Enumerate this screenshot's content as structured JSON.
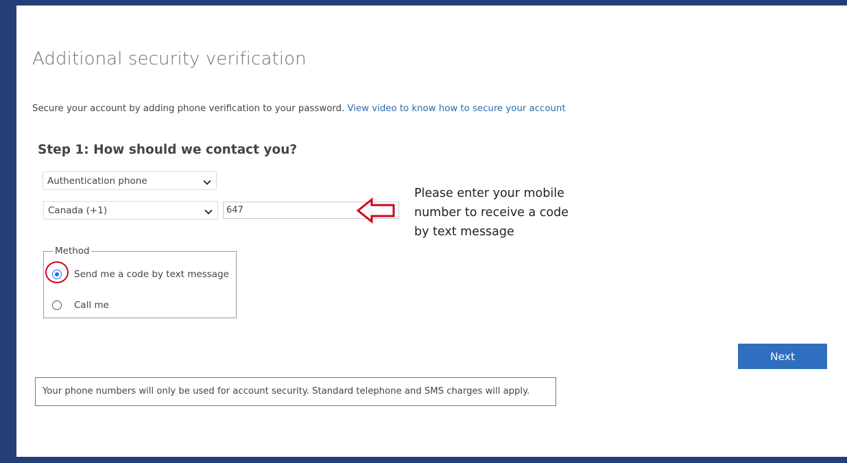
{
  "page": {
    "title": "Additional security verification",
    "intro_text": "Secure your account by adding phone verification to your password.",
    "intro_link": "View video to know how to secure your account"
  },
  "step1": {
    "title": "Step 1: How should we contact you?",
    "contact_method_selected": "Authentication phone",
    "country_selected": "Canada (+1)",
    "phone_value": "647"
  },
  "annotation": {
    "note": "Please enter your mobile number to receive a code by text message",
    "arrow_color": "#d0021b",
    "highlight_color": "#d0021b"
  },
  "method": {
    "legend": "Method",
    "options": [
      {
        "label": "Send me a code by text message",
        "checked": true
      },
      {
        "label": "Call me",
        "checked": false
      }
    ]
  },
  "actions": {
    "next_label": "Next",
    "accent_color": "#2e6fbf"
  },
  "footer": {
    "disclaimer": "Your phone numbers will only be used for account security. Standard telephone and SMS charges will apply."
  },
  "icons": {
    "dropdown": "chevron-down-icon",
    "arrow": "left-arrow-icon"
  }
}
